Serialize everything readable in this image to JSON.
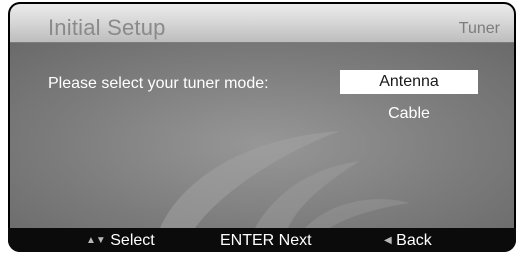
{
  "header": {
    "title": "Initial Setup",
    "section": "Tuner"
  },
  "main": {
    "prompt": "Please select your tuner mode:",
    "options": [
      {
        "label": "Antenna",
        "selected": true
      },
      {
        "label": "Cable",
        "selected": false
      }
    ]
  },
  "footer": {
    "select_label": "Select",
    "enter_label": "ENTER  Next",
    "back_label": "Back"
  },
  "icons": {
    "up_down": "up-down-arrows-icon",
    "back": "back-arrow-icon"
  },
  "colors": {
    "header_bg": "#d8d8d8",
    "body_bg": "#7b7b7b",
    "footer_bg": "#0b0b0b",
    "highlight": "#ffffff"
  }
}
